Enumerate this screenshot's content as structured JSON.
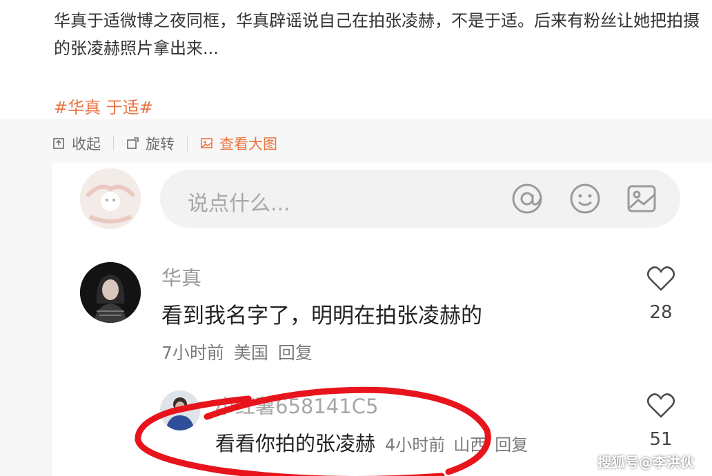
{
  "post": {
    "text": "华真于适微博之夜同框，华真辟谣说自己在拍张凌赫，不是于适。后来有粉丝让她把拍摄的张凌赫照片拿出来...",
    "hashtag": "#华真 于适#"
  },
  "toolbar": {
    "collapse_label": "收起",
    "rotate_label": "旋转",
    "view_large_label": "查看大图"
  },
  "comment_box": {
    "placeholder": "说点什么..."
  },
  "comments": [
    {
      "author": "华真",
      "text": "看到我名字了，明明在拍张凌赫的",
      "time": "7小时前",
      "location": "美国",
      "reply_label": "回复",
      "likes": "28",
      "replies": [
        {
          "author": "小红薯658141C5",
          "text": "看看你拍的张凌赫",
          "time": "4小时前",
          "location": "山西",
          "reply_label": "回复",
          "likes": "51"
        }
      ]
    }
  ],
  "watermark": "搜狐号@李洪伙",
  "colors": {
    "hashtag": "#eb7340",
    "annotation_circle": "#e8141c"
  }
}
